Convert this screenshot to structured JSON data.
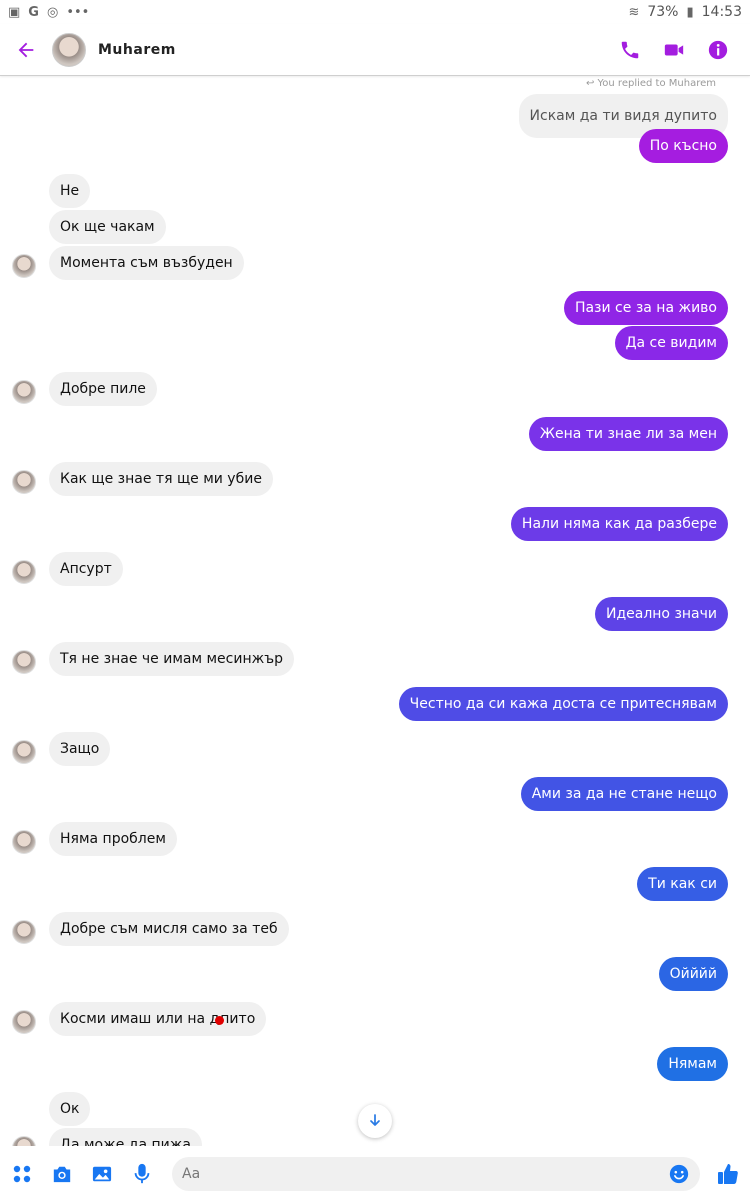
{
  "status_bar": {
    "left_icons": [
      "image-icon",
      "google-icon",
      "instagram-icon",
      "more-icon"
    ],
    "battery": "73%",
    "time": "14:53"
  },
  "header": {
    "contact_name": "Muharem",
    "accent_color": "#a31ddf"
  },
  "conversation": {
    "replied_note": "You replied to Muharem",
    "quoted_text": "Искам да ти видя дупито",
    "messages": [
      {
        "dir": "out",
        "text": "По късно",
        "color": "#a51de0"
      },
      {
        "dir": "in",
        "text": "Не"
      },
      {
        "dir": "in",
        "text": "Ок ще чакам"
      },
      {
        "dir": "in",
        "text": "Момента съм възбуден",
        "avatar": true
      },
      {
        "dir": "out",
        "text": "Пази се за на живо",
        "color": "#9025e6"
      },
      {
        "dir": "out",
        "text": "Да се видим",
        "color": "#8a28e8"
      },
      {
        "dir": "in",
        "text": "Добре пиле",
        "avatar": true
      },
      {
        "dir": "out",
        "text": "Жена ти знае ли за мен",
        "color": "#7a33e9"
      },
      {
        "dir": "in",
        "text": "Как ще знае тя ще ми убие",
        "avatar": true
      },
      {
        "dir": "out",
        "text": "Нали няма как да разбере",
        "color": "#6c3be8"
      },
      {
        "dir": "in",
        "text": "Апсурт",
        "avatar": true
      },
      {
        "dir": "out",
        "text": "Идеално значи",
        "color": "#5e43e7"
      },
      {
        "dir": "in",
        "text": "Тя не знае че имам месинжър",
        "avatar": true
      },
      {
        "dir": "out",
        "text": "Честно да си кажа доста се притеснявам",
        "color": "#4f4ce6"
      },
      {
        "dir": "in",
        "text": "Защо",
        "avatar": true
      },
      {
        "dir": "out",
        "text": "Ами за да не стане нещо",
        "color": "#4254e5"
      },
      {
        "dir": "in",
        "text": "Няма проблем",
        "avatar": true
      },
      {
        "dir": "out",
        "text": "Ти как си",
        "color": "#365ee5"
      },
      {
        "dir": "in",
        "text": "Добре съм мисля само за теб",
        "avatar": true
      },
      {
        "dir": "out",
        "text": "Ойййй",
        "color": "#2b66e4"
      },
      {
        "dir": "in",
        "text_before": "Косми имаш или на д",
        "text_after": "пито",
        "avatar": true
      },
      {
        "dir": "out",
        "text": "Нямам",
        "color": "#2070e4"
      },
      {
        "dir": "in",
        "text": "Ок"
      },
      {
        "dir": "in",
        "text": "Да може да пижа"
      }
    ]
  },
  "composer": {
    "placeholder": "Aa"
  }
}
